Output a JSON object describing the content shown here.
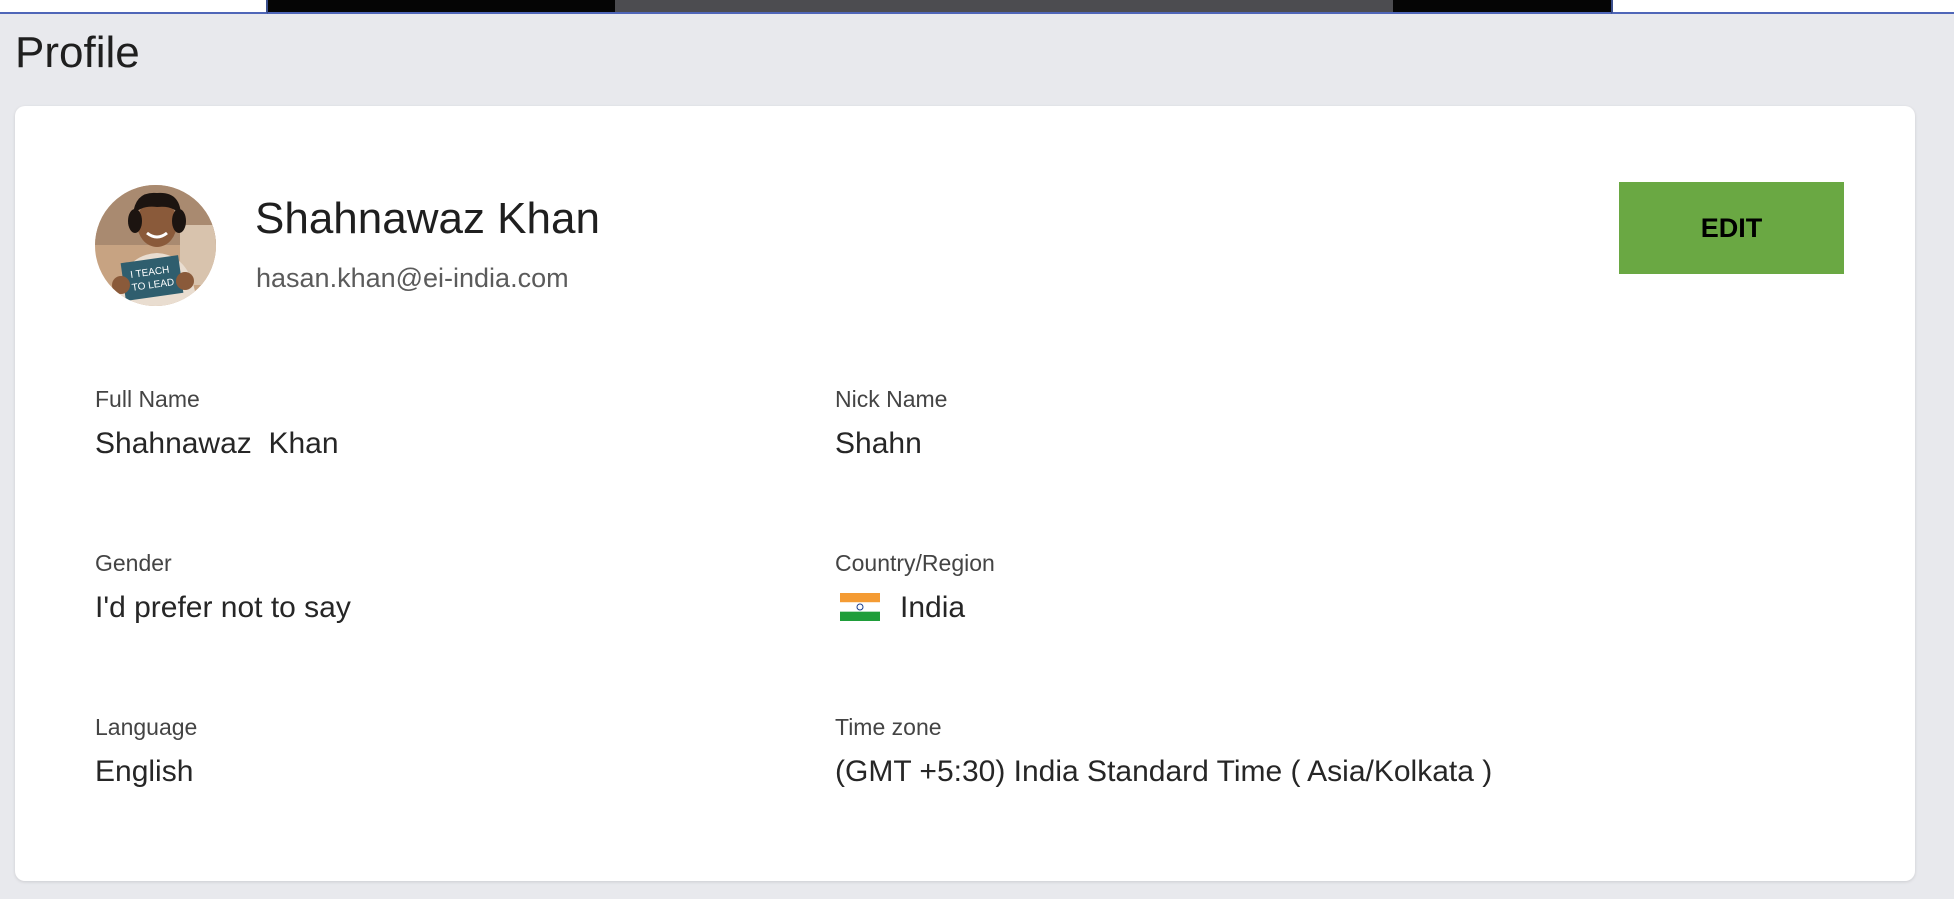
{
  "page": {
    "title": "Profile"
  },
  "profile": {
    "display_name": "Shahnawaz Khan",
    "email": "hasan.khan@ei-india.com",
    "avatar_sign_text": "I TEACH TO LEAD",
    "edit_label": "EDIT"
  },
  "fields": {
    "full_name": {
      "label": "Full Name",
      "value": "Shahnawaz  Khan"
    },
    "nick_name": {
      "label": "Nick Name",
      "value": "Shahn"
    },
    "gender": {
      "label": "Gender",
      "value": "I'd prefer not to say"
    },
    "country": {
      "label": "Country/Region",
      "value": "India",
      "flag_icon": "india-flag-icon"
    },
    "language": {
      "label": "Language",
      "value": "English"
    },
    "time_zone": {
      "label": "Time zone",
      "value": "(GMT +5:30) India Standard Time ( Asia/Kolkata )"
    }
  },
  "colors": {
    "edit_button": "#6aa843",
    "page_background": "#e8e9ed",
    "card_background": "#ffffff"
  }
}
